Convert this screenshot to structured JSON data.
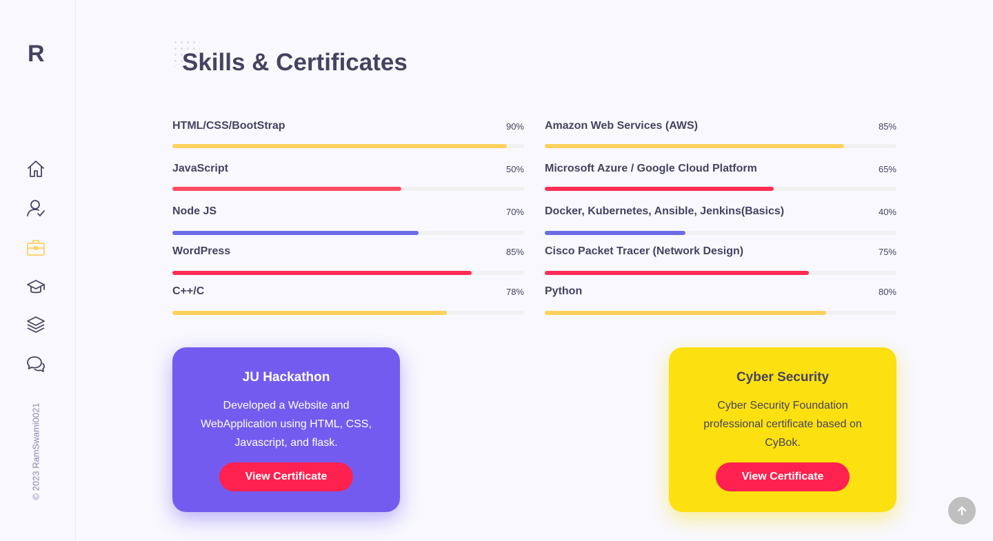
{
  "brand": {
    "logo": "R"
  },
  "sidebar": {
    "items": [
      {
        "name": "home",
        "icon": "home-icon",
        "active": false
      },
      {
        "name": "about",
        "icon": "user-check-icon",
        "active": false
      },
      {
        "name": "skills",
        "icon": "briefcase-icon",
        "active": true
      },
      {
        "name": "education",
        "icon": "graduation-cap-icon",
        "active": false
      },
      {
        "name": "portfolio",
        "icon": "layers-icon",
        "active": false
      },
      {
        "name": "contact",
        "icon": "chat-bubbles-icon",
        "active": false
      }
    ],
    "copyright": "© 2023 RamSwami0021"
  },
  "section": {
    "title": "Skills & Certificates"
  },
  "skills": {
    "left": [
      {
        "name": "HTML/CSS/BootStrap",
        "percent": "90%",
        "value": 0.95,
        "color": "#ffd15c"
      },
      {
        "name": "JavaScript",
        "percent": "50%",
        "value": 0.65,
        "color": "#ff4c60"
      },
      {
        "name": "Node JS",
        "percent": "70%",
        "value": 0.7,
        "color": "#6c6ce5"
      },
      {
        "name": "WordPress",
        "percent": "85%",
        "value": 0.85,
        "color": "#ff2d55"
      },
      {
        "name": "C++/C",
        "percent": "78%",
        "value": 0.78,
        "color": "#ffd15c"
      }
    ],
    "right": [
      {
        "name": "Amazon Web Services (AWS)",
        "percent": "85%",
        "value": 0.85,
        "color": "#ffd15c"
      },
      {
        "name": "Microsoft Azure / Google Cloud Platform",
        "percent": "65%",
        "value": 0.65,
        "color": "#ff2d55"
      },
      {
        "name": "Docker, Kubernetes, Ansible, Jenkins(Basics)",
        "percent": "40%",
        "value": 0.4,
        "color": "#6c6ce5"
      },
      {
        "name": "Cisco Packet Tracer (Network Design)",
        "percent": "75%",
        "value": 0.75,
        "color": "#ff2d55"
      },
      {
        "name": "Python",
        "percent": "80%",
        "value": 0.8,
        "color": "#ffd15c"
      }
    ]
  },
  "cards": [
    {
      "title": "JU Hackathon",
      "description": "Developed a Website and WebApplication using HTML, CSS, Javascript, and flask.",
      "button_label": "View Certificate",
      "background": "#745bef",
      "text_color": "#ffffff"
    },
    {
      "title": "Cyber Security",
      "description": "Cyber Security Foundation professional certificate based on CyBok.",
      "button_label": "View Certificate",
      "background": "#fde00f",
      "text_color": "#454360"
    }
  ],
  "colors": {
    "accent": "#ffd15c",
    "text": "#454360",
    "button": "#ff214f"
  }
}
